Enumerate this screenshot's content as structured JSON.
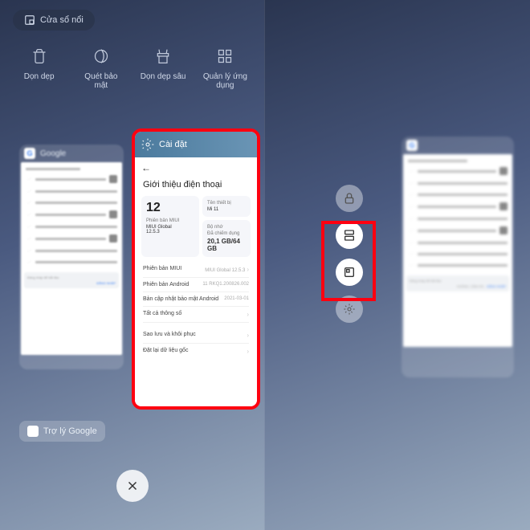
{
  "pip_label": "Cửa sổ nổi",
  "actions": {
    "clean": "Dọn dẹp",
    "security": "Quét bảo mật",
    "deepclean": "Dọn dẹp sâu",
    "manage": "Quản lý ứng dụng"
  },
  "google_label": "Google",
  "assistant_label": "Trợ lý Google",
  "settings": {
    "title": "Cài đặt",
    "page_title": "Giới thiệu điện thoại",
    "miui_version": "12",
    "version_label": "Phiên bản MIUI",
    "version_sub": "MIUI Global",
    "version_num": "12.5.3",
    "device_label": "Tên thiết bị",
    "device_name": "Mi 11",
    "storage_label": "Bộ nhớ",
    "storage_sub": "Đã chiếm dụng",
    "storage_val": "20,1 GB/64 GB",
    "rows": {
      "miui": {
        "k": "Phiên bản MIUI",
        "v": "MIUI Global 12.5.3"
      },
      "android": {
        "k": "Phiên bản Android",
        "v": "11 RKQ1.200826.002"
      },
      "security": {
        "k": "Bản cập nhật bảo mật Android",
        "v": "2021-03-01"
      },
      "specs": {
        "k": "Tất cả thông số"
      },
      "backup": {
        "k": "Sao lưu và khôi phục"
      },
      "reset": {
        "k": "Đặt lại dữ liệu gốc"
      }
    }
  },
  "google_banner": {
    "title": "Đăng nhập để bắt đầu",
    "btn": "ĐĂNG NHẬP",
    "cancel": "KHÔNG, CẢM ƠN"
  }
}
